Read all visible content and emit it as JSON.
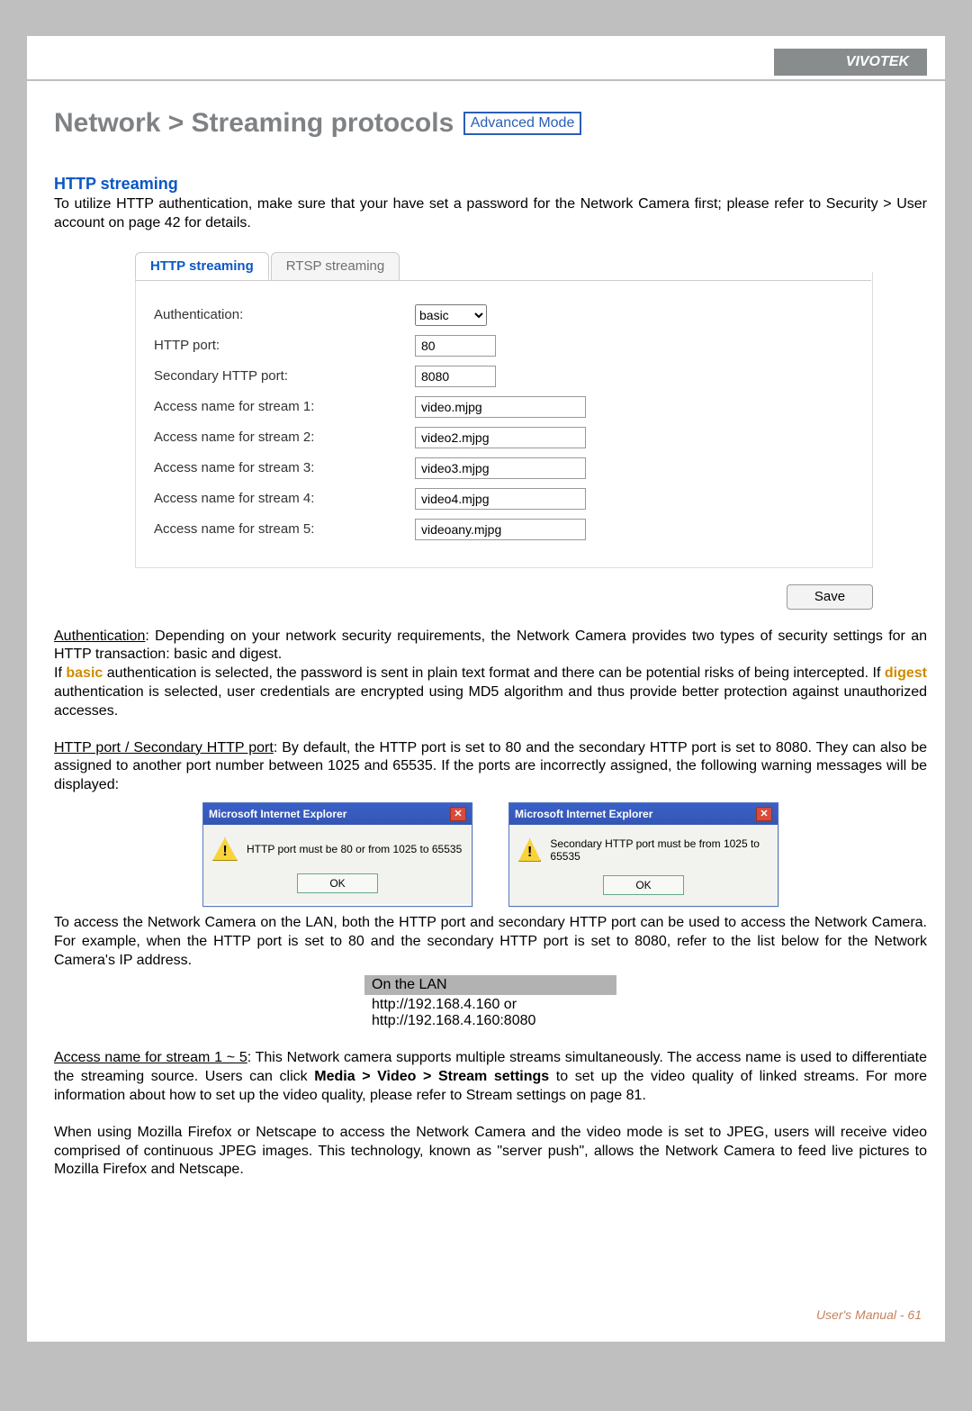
{
  "brand": "VIVOTEK",
  "page_title": "Network > Streaming protocols",
  "advanced_badge": "Advanced Mode",
  "http_streaming_heading": "HTTP streaming",
  "intro_para": "To utilize HTTP authentication, make sure that your have set a password for the Network Camera first; please refer to Security > User account on page 42 for details.",
  "tabs": {
    "http": "HTTP streaming",
    "rtsp": "RTSP streaming"
  },
  "form": {
    "auth_label": "Authentication:",
    "auth_value": "basic",
    "http_port_label": "HTTP port:",
    "http_port_value": "80",
    "sec_http_port_label": "Secondary HTTP port:",
    "sec_http_port_value": "8080",
    "stream1_label": "Access name for stream 1:",
    "stream1_value": "video.mjpg",
    "stream2_label": "Access name for stream 2:",
    "stream2_value": "video2.mjpg",
    "stream3_label": "Access name for stream 3:",
    "stream3_value": "video3.mjpg",
    "stream4_label": "Access name for stream 4:",
    "stream4_value": "video4.mjpg",
    "stream5_label": "Access name for stream 5:",
    "stream5_value": "videoany.mjpg"
  },
  "save_label": "Save",
  "auth_para_lead": "Authentication",
  "auth_para_rest_1": ": Depending on your network security requirements, the Network Camera provides two types of security settings for an HTTP transaction: basic and digest.",
  "auth_para_if": "If ",
  "auth_para_basic": "basic",
  "auth_para_mid": " authentication is selected, the password is sent in plain text format and there can be potential risks of being intercepted. If ",
  "auth_para_digest": "digest",
  "auth_para_end": " authentication is selected, user credentials are encrypted using MD5 algorithm and thus provide better protection against unauthorized accesses.",
  "port_para_lead": "HTTP port / Secondary HTTP port",
  "port_para_rest": ": By default, the HTTP port is set to 80 and the secondary HTTP port is set to 8080. They can also be assigned to another port number between 1025 and 65535. If the ports are incorrectly assigned, the following warning messages will be displayed:",
  "dialog1": {
    "title": "Microsoft Internet Explorer",
    "msg": "HTTP port must be 80 or from 1025 to 65535",
    "ok": "OK"
  },
  "dialog2": {
    "title": "Microsoft Internet Explorer",
    "msg": "Secondary HTTP port must be from 1025 to 65535",
    "ok": "OK"
  },
  "lan_para": "To access the Network Camera on the LAN, both the HTTP port and secondary HTTP port can be used to access the Network Camera. For example, when the HTTP port is set to 80 and the secondary HTTP port is set to 8080, refer to the list below for the Network Camera's IP address.",
  "lan_box": {
    "header": "On the LAN",
    "line1": "http://192.168.4.160  or",
    "line2": "http://192.168.4.160:8080"
  },
  "access_lead": "Access name for stream 1 ~ 5",
  "access_rest_a": ": This Network camera supports multiple streams simultaneously. The access name is used to differentiate the streaming source. Users can click ",
  "access_bold": "Media > Video > Stream settings",
  "access_rest_b": " to set up the video quality of linked streams. For more information about how to set up the video quality, please refer to Stream settings on page 81.",
  "firefox_para": "When using Mozilla Firefox or Netscape to access the Network Camera and the video mode is set to JPEG, users will receive video comprised of continuous JPEG images. This technology, known as \"server push\", allows the Network Camera to feed live pictures to Mozilla Firefox and Netscape.",
  "footer": "User's Manual - 61"
}
